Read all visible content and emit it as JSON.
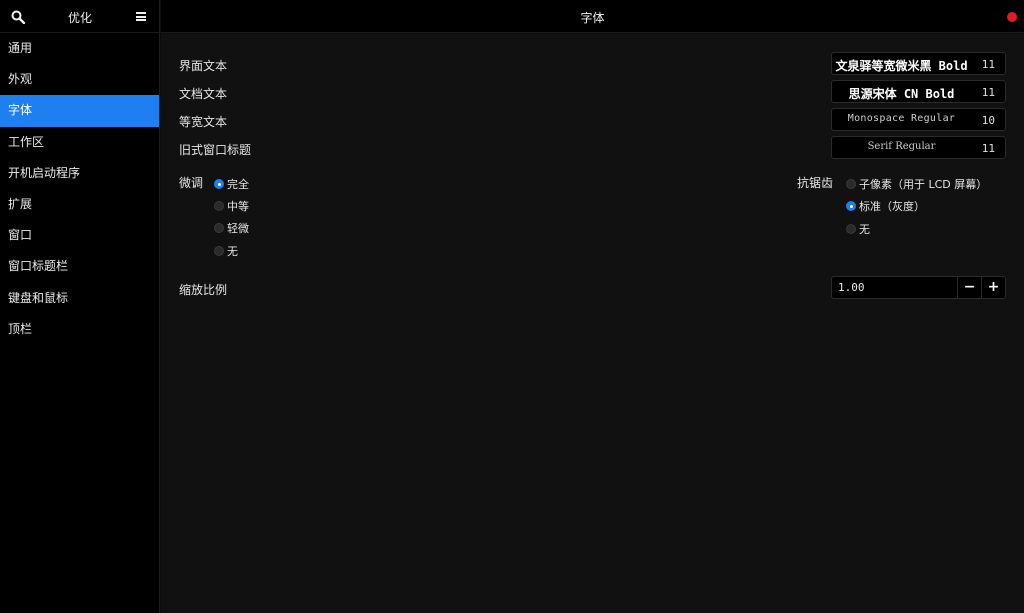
{
  "sidebar": {
    "title": "优化",
    "items": [
      {
        "label": "通用"
      },
      {
        "label": "外观"
      },
      {
        "label": "字体"
      },
      {
        "label": "工作区"
      },
      {
        "label": "开机启动程序"
      },
      {
        "label": "扩展"
      },
      {
        "label": "窗口"
      },
      {
        "label": "窗口标题栏"
      },
      {
        "label": "键盘和鼠标"
      },
      {
        "label": "顶栏"
      }
    ],
    "active_index": 2
  },
  "header": {
    "title": "字体"
  },
  "fonts": {
    "interface": {
      "label": "界面文本",
      "font": "文泉驿等宽微米黑 Bold",
      "size": "11"
    },
    "document": {
      "label": "文档文本",
      "font": "思源宋体 CN Bold",
      "size": "11"
    },
    "monospace": {
      "label": "等宽文本",
      "font": "Monospace Regular",
      "size": "10"
    },
    "legacy_title": {
      "label": "旧式窗口标题",
      "font": "Serif Regular",
      "size": "11"
    }
  },
  "hinting": {
    "label": "微调",
    "options": [
      "完全",
      "中等",
      "轻微",
      "无"
    ],
    "selected": "完全"
  },
  "antialiasing": {
    "label": "抗锯齿",
    "options": [
      "子像素（用于 LCD 屏幕）",
      "标准（灰度）",
      "无"
    ],
    "selected": "标准（灰度）"
  },
  "scaling": {
    "label": "缩放比例",
    "value": "1.00",
    "minus": "−",
    "plus": "+"
  },
  "colors": {
    "accent": "#1e7ff0",
    "close": "#e01b24"
  }
}
